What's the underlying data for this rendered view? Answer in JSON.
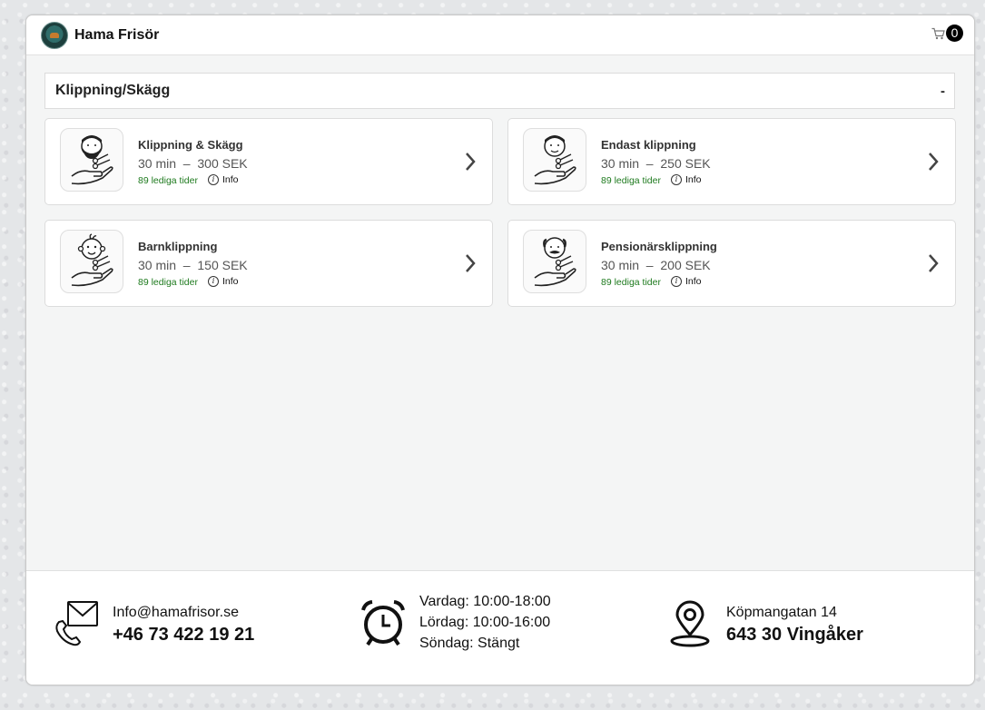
{
  "header": {
    "brand": "Hama Frisör",
    "cart_count": "0"
  },
  "category": {
    "title": "Klippning/Skägg",
    "toggle": "-"
  },
  "services": [
    {
      "name": "Klippning & Skägg",
      "meta": "30 min  –  300 SEK",
      "availability": "89 lediga tider",
      "info": "Info",
      "icon": "bearded-man-haircut-icon"
    },
    {
      "name": "Endast klippning",
      "meta": "30 min  –  250 SEK",
      "availability": "89 lediga tider",
      "info": "Info",
      "icon": "man-haircut-icon"
    },
    {
      "name": "Barnklippning",
      "meta": "30 min  –  150 SEK",
      "availability": "89 lediga tider",
      "info": "Info",
      "icon": "child-haircut-icon"
    },
    {
      "name": "Pensionärsklippning",
      "meta": "30 min  –  200 SEK",
      "availability": "89 lediga tider",
      "info": "Info",
      "icon": "senior-haircut-icon"
    }
  ],
  "footer": {
    "email": "Info@hamafrisor.se",
    "phone": "+46 73 422 19 21",
    "hours": [
      "Vardag: 10:00-18:00",
      "Lördag: 10:00-16:00",
      "Söndag: Stängt"
    ],
    "street": "Köpmangatan 14",
    "city": "643 30 Vingåker"
  },
  "colors": {
    "availability": "#1e7a1e",
    "background": "#f4f5f5"
  }
}
